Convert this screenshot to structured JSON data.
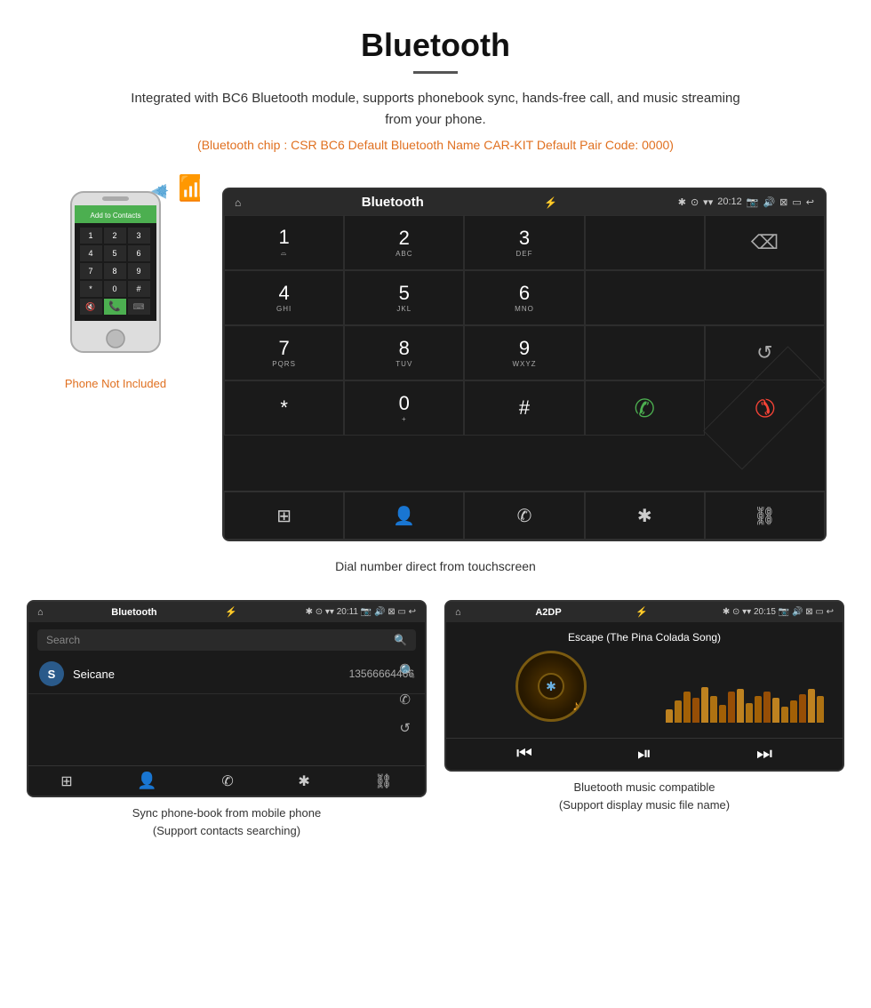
{
  "page": {
    "title": "Bluetooth",
    "description": "Integrated with BC6 Bluetooth module, supports phonebook sync, hands-free call, and music streaming from your phone.",
    "specs": "(Bluetooth chip : CSR BC6   Default Bluetooth Name CAR-KIT    Default Pair Code: 0000)",
    "dialer_caption": "Dial number direct from touchscreen",
    "phonebook_caption": "Sync phone-book from mobile phone\n(Support contacts searching)",
    "music_caption": "Bluetooth music compatible\n(Support display music file name)"
  },
  "phone_label": "Phone Not Included",
  "dialer": {
    "title": "Bluetooth",
    "time": "20:12",
    "keys": [
      {
        "digit": "1",
        "sub": "⌓"
      },
      {
        "digit": "2",
        "sub": "ABC"
      },
      {
        "digit": "3",
        "sub": "DEF"
      },
      {
        "digit": "",
        "sub": ""
      },
      {
        "digit": "⌫",
        "sub": ""
      },
      {
        "digit": "4",
        "sub": "GHI"
      },
      {
        "digit": "5",
        "sub": "JKL"
      },
      {
        "digit": "6",
        "sub": "MNO"
      },
      {
        "digit": "",
        "sub": ""
      },
      {
        "digit": "",
        "sub": ""
      },
      {
        "digit": "7",
        "sub": "PQRS"
      },
      {
        "digit": "8",
        "sub": "TUV"
      },
      {
        "digit": "9",
        "sub": "WXYZ"
      },
      {
        "digit": "",
        "sub": ""
      },
      {
        "digit": "↺",
        "sub": ""
      },
      {
        "digit": "*",
        "sub": ""
      },
      {
        "digit": "0",
        "sub": "+"
      },
      {
        "digit": "#",
        "sub": ""
      },
      {
        "digit": "✆",
        "sub": ""
      },
      {
        "digit": "✆",
        "sub": "end"
      }
    ],
    "bottom_icons": [
      "⊞",
      "👤",
      "✆",
      "✱",
      "⛓"
    ]
  },
  "phonebook": {
    "title": "Bluetooth",
    "time": "20:11",
    "search_placeholder": "Search",
    "contact_initial": "S",
    "contact_name": "Seicane",
    "contact_number": "13566664466",
    "bottom_icons": [
      "⊞",
      "👤",
      "✆",
      "✱",
      "⛓"
    ]
  },
  "music": {
    "title": "A2DP",
    "time": "20:15",
    "song_title": "Escape (The Pina Colada Song)",
    "visualizer_bars": [
      15,
      25,
      35,
      28,
      40,
      30,
      20,
      35,
      38,
      22,
      30,
      35,
      28,
      18,
      25,
      32,
      38,
      30
    ],
    "controls": [
      "⏮",
      "⏯",
      "⏭"
    ]
  }
}
